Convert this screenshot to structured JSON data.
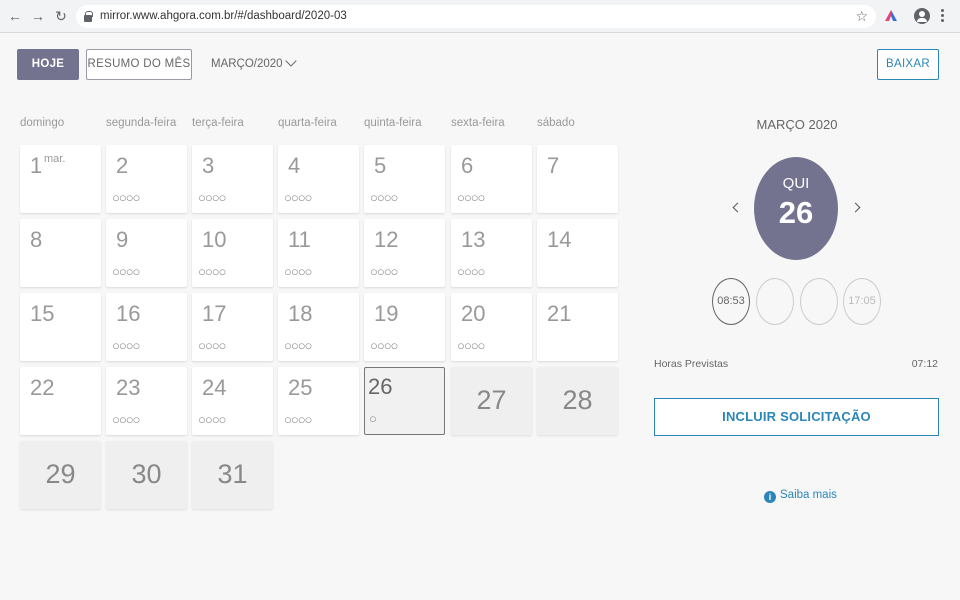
{
  "browser": {
    "url": "mirror.www.ahgora.com.br/#/dashboard/2020-03",
    "back_glyph": "←",
    "forward_glyph": "→",
    "reload_glyph": "↻",
    "star_glyph": "☆"
  },
  "toolbar": {
    "hoje_label": "HOJE",
    "resumo_label": "RESUMO DO MÊS",
    "month_label": "MARÇO/2020",
    "baixar_label": "BAIXAR"
  },
  "calendar": {
    "weekdays": [
      "domingo",
      "segunda-feira",
      "terça-feira",
      "quarta-feira",
      "quinta-feira",
      "sexta-feira",
      "sábado"
    ],
    "first_day_suffix": "mar.",
    "days": [
      {
        "n": "1",
        "dots": ""
      },
      {
        "n": "2",
        "dots": "○○○○"
      },
      {
        "n": "3",
        "dots": "○○○○"
      },
      {
        "n": "4",
        "dots": "○○○○"
      },
      {
        "n": "5",
        "dots": "○○○○"
      },
      {
        "n": "6",
        "dots": "○○○○"
      },
      {
        "n": "7",
        "dots": ""
      },
      {
        "n": "8",
        "dots": ""
      },
      {
        "n": "9",
        "dots": "○○○○"
      },
      {
        "n": "10",
        "dots": "○○○○"
      },
      {
        "n": "11",
        "dots": "○○○○"
      },
      {
        "n": "12",
        "dots": "○○○○"
      },
      {
        "n": "13",
        "dots": "○○○○"
      },
      {
        "n": "14",
        "dots": ""
      },
      {
        "n": "15",
        "dots": ""
      },
      {
        "n": "16",
        "dots": "○○○○"
      },
      {
        "n": "17",
        "dots": "○○○○"
      },
      {
        "n": "18",
        "dots": "○○○○"
      },
      {
        "n": "19",
        "dots": "○○○○"
      },
      {
        "n": "20",
        "dots": "○○○○"
      },
      {
        "n": "21",
        "dots": ""
      },
      {
        "n": "22",
        "dots": ""
      },
      {
        "n": "23",
        "dots": "○○○○"
      },
      {
        "n": "24",
        "dots": "○○○○"
      },
      {
        "n": "25",
        "dots": "○○○○"
      },
      {
        "n": "26",
        "dots": "○",
        "today": true
      },
      {
        "n": "27",
        "future": true
      },
      {
        "n": "28",
        "future": true
      },
      {
        "n": "29",
        "future": true
      },
      {
        "n": "30",
        "future": true
      },
      {
        "n": "31",
        "future": true
      }
    ]
  },
  "side": {
    "month_title": "MARÇO 2020",
    "weekday_short": "QUI",
    "day_number": "26",
    "punches": [
      "08:53",
      "",
      "",
      "17:05"
    ],
    "horas_label": "Horas Previstas",
    "horas_value": "07:12",
    "incluir_label": "INCLUIR SOLICITAÇÃO",
    "info_glyph": "i",
    "saiba_label": "Saiba mais"
  },
  "colors": {
    "accent": "#737390",
    "link": "#2a86b8"
  }
}
